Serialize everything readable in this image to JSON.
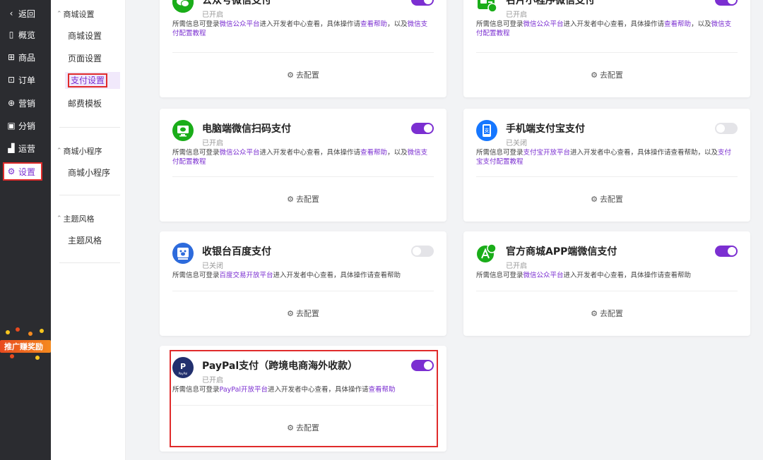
{
  "rail": {
    "items": [
      {
        "label": "返回",
        "icon": "chevron-left-icon"
      },
      {
        "label": "概览",
        "icon": "overview-icon"
      },
      {
        "label": "商品",
        "icon": "goods-icon"
      },
      {
        "label": "订单",
        "icon": "order-icon"
      },
      {
        "label": "营销",
        "icon": "marketing-icon"
      },
      {
        "label": "分销",
        "icon": "distribution-icon"
      },
      {
        "label": "运营",
        "icon": "operation-icon"
      },
      {
        "label": "设置",
        "icon": "gear-icon"
      }
    ],
    "promo_text": "推广赚奖励"
  },
  "subnav": {
    "groups": [
      {
        "title": "商城设置",
        "items": [
          "商城设置",
          "页面设置",
          "支付设置",
          "邮费模板"
        ]
      },
      {
        "title": "商城小程序",
        "items": [
          "商城小程序"
        ]
      },
      {
        "title": "主题风格",
        "items": [
          "主题风格"
        ]
      }
    ]
  },
  "payments": [
    {
      "title": "公众号微信支付",
      "status": "已开启",
      "on": true,
      "desc_pre": "所需信息可登录",
      "link1": "微信公众平台",
      "desc_mid": "进入开发者中心查看，具体操作请",
      "link2": "查看帮助",
      "desc_post": "，以及",
      "link3": "微信支付配置教程",
      "config": "去配置"
    },
    {
      "title": "名片小程序微信支付",
      "status": "已开启",
      "on": true,
      "desc_pre": "所需信息可登录",
      "link1": "微信公众平台",
      "desc_mid": "进入开发者中心查看，具体操作请",
      "link2": "查看帮助",
      "desc_post": "，以及",
      "link3": "微信支付配置教程",
      "config": "去配置"
    },
    {
      "title": "电脑端微信扫码支付",
      "status": "已开启",
      "on": true,
      "desc_pre": "所需信息可登录",
      "link1": "微信公众平台",
      "desc_mid": "进入开发者中心查看，具体操作请",
      "link2": "查看帮助",
      "desc_post": "，以及",
      "link3": "微信支付配置教程",
      "config": "去配置"
    },
    {
      "title": "手机端支付宝支付",
      "status": "已关闭",
      "on": false,
      "desc_pre": "所需信息可登录",
      "link1": "支付宝开放平台",
      "desc_mid": "进入开发者中心查看，具体操作请查看帮助，以及",
      "link2": "",
      "desc_post": "",
      "link3": "支付宝支付配置教程",
      "config": "去配置"
    },
    {
      "title": "收银台百度支付",
      "status": "已关闭",
      "on": false,
      "desc_pre": "所需信息可登录",
      "link1": "百度交易开放平台",
      "desc_mid": "进入开发者中心查看，具体操作请查看帮助",
      "link2": "",
      "desc_post": "",
      "link3": "",
      "config": "去配置"
    },
    {
      "title": "官方商城APP端微信支付",
      "status": "已开启",
      "on": true,
      "desc_pre": "所需信息可登录",
      "link1": "微信公众平台",
      "desc_mid": "进入开发者中心查看，具体操作请查看帮助",
      "link2": "",
      "desc_post": "",
      "link3": "",
      "config": "去配置"
    },
    {
      "title": "PayPal支付（跨境电商海外收款）",
      "status": "已开启",
      "on": true,
      "desc_pre": "所需信息可登录",
      "link1": "PayPal开放平台",
      "desc_mid": "进入开发者中心查看，具体操作请",
      "link2": "查看帮助",
      "desc_post": "",
      "link3": "",
      "config": "去配置"
    }
  ],
  "colors": {
    "accent": "#7b2fd1",
    "wechat": "#1aad19",
    "alipay": "#1677ff",
    "baidu": "#2d6bdc",
    "paypal": "#22306e",
    "highlight": "#e02b2b"
  }
}
